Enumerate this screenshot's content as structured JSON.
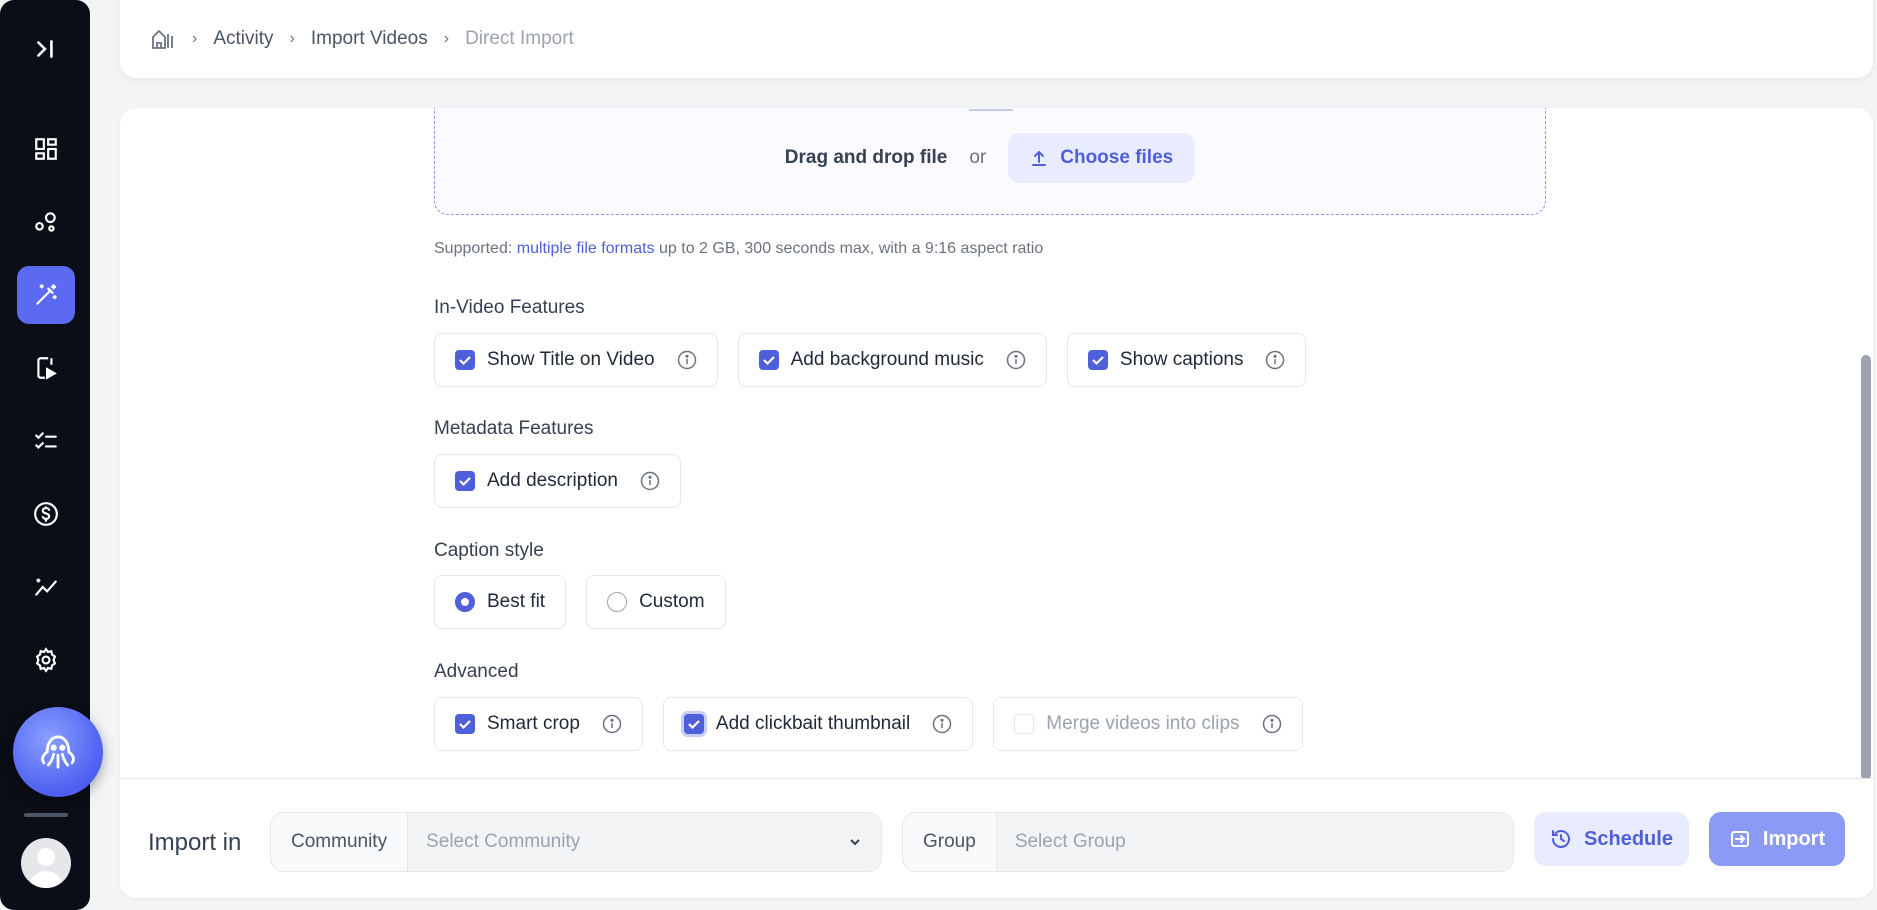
{
  "sidebar": {
    "items": [
      {
        "icon": "collapse-icon"
      },
      {
        "icon": "dashboard-icon"
      },
      {
        "icon": "nodes-icon"
      },
      {
        "icon": "magic-wand-icon",
        "active": true
      },
      {
        "icon": "phone-video-icon"
      },
      {
        "icon": "checklist-icon"
      },
      {
        "icon": "dollar-icon"
      },
      {
        "icon": "analytics-icon"
      },
      {
        "icon": "gear-icon"
      }
    ],
    "assistant_icon": "octopus-icon",
    "avatar_icon": "user-avatar-icon"
  },
  "breadcrumb": {
    "home_icon": "home-icon",
    "items": [
      "Activity",
      "Import Videos",
      "Direct Import"
    ]
  },
  "dropzone": {
    "drag_text": "Drag and drop file",
    "or_text": "or",
    "choose_label": "Choose files"
  },
  "supported": {
    "prefix": "Supported:",
    "link": "multiple file formats",
    "suffix": "up to 2 GB, 300 seconds max, with a 9:16 aspect ratio"
  },
  "in_video": {
    "label": "In-Video Features",
    "options": [
      {
        "label": "Show Title on Video",
        "checked": true
      },
      {
        "label": "Add background music",
        "checked": true
      },
      {
        "label": "Show captions",
        "checked": true
      }
    ]
  },
  "metadata": {
    "label": "Metadata Features",
    "options": [
      {
        "label": "Add description",
        "checked": true
      }
    ]
  },
  "caption_style": {
    "label": "Caption style",
    "options": [
      {
        "label": "Best fit",
        "selected": true
      },
      {
        "label": "Custom",
        "selected": false
      }
    ]
  },
  "advanced": {
    "label": "Advanced",
    "options": [
      {
        "label": "Smart crop",
        "checked": true
      },
      {
        "label": "Add clickbait thumbnail",
        "checked": true
      },
      {
        "label": "Merge videos into clips",
        "checked": false,
        "disabled": true
      }
    ]
  },
  "bottom": {
    "import_in": "Import in",
    "community_label": "Community",
    "community_placeholder": "Select Community",
    "group_label": "Group",
    "group_placeholder": "Select Group",
    "schedule_label": "Schedule",
    "import_label": "Import"
  },
  "colors": {
    "accent": "#4f5fd9",
    "sidebar_bg": "#0b0d17",
    "import_btn": "#8b9af5"
  }
}
